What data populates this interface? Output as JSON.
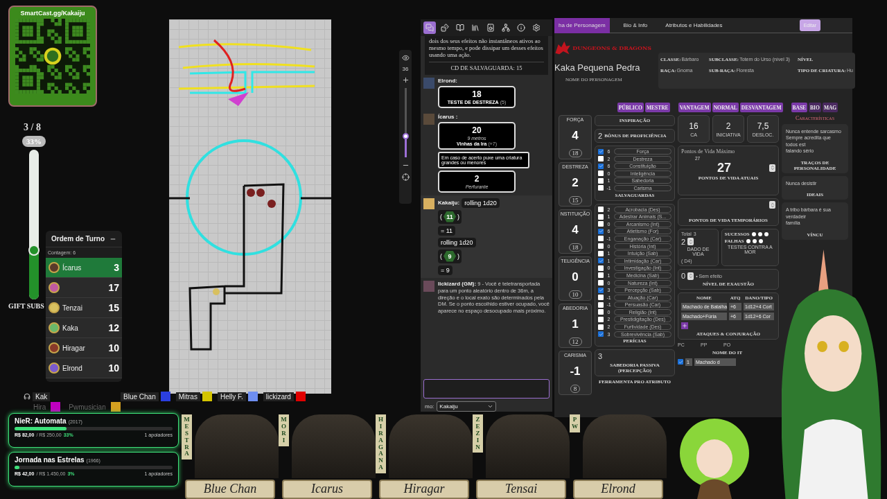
{
  "qr_widget": {
    "url": "SmartCast.gg/Kakaiju"
  },
  "sub_goal": {
    "count": "3 / 8",
    "percent": "33%",
    "level": 0.33,
    "label": "GIFT SUBS"
  },
  "turn_order": {
    "title": "Ordem de Turno",
    "count": "Contagem: 6",
    "entries": [
      {
        "name": "Ícarus",
        "initiative": "3",
        "selected": true
      },
      {
        "initiative": "17",
        "selected": false
      },
      {
        "name": "Tenzai",
        "initiative": "15",
        "selected": false
      },
      {
        "name": "Kaka",
        "initiative": "12",
        "selected": false
      },
      {
        "name": "Hiragar",
        "initiative": "10",
        "selected": false
      },
      {
        "name": "Elrond",
        "initiative": "10",
        "selected": false
      }
    ]
  },
  "map_toolbar": {
    "zoom": "36",
    "zoom_slider": {
      "level": 0.3
    }
  },
  "voice_members": [
    {
      "name": "Kak",
      "kind": "speaking"
    },
    {
      "name": "Blue Chan",
      "kind": "member",
      "color": "#2b3fe0"
    },
    {
      "name": "Mitras",
      "kind": "member",
      "color": "#d4c400"
    },
    {
      "name": "Helly F.",
      "kind": "member",
      "color": "#6e8ef0"
    },
    {
      "name": "lickizard",
      "kind": "member",
      "color": "#e00000"
    }
  ],
  "voice_members_faded": [
    {
      "name": "Hira",
      "color": "#c000c0"
    },
    {
      "name": "Pwmusician",
      "color": "#d4a020"
    }
  ],
  "funding_goals": [
    {
      "title": "NieR: Automata",
      "year": "(2017)",
      "raised": "R$ 82,00",
      "target": "/ R$ 250,00",
      "percent": "33%",
      "level": 0.33,
      "supporters": "1 apoiadores"
    },
    {
      "title": "Jornada nas Estrelas",
      "year": "(1966)",
      "raised": "R$ 42,00",
      "target": "/ R$ 1.450,00",
      "percent": "3%",
      "level": 0.03,
      "supporters": "1 apoiadores"
    }
  ],
  "chat": {
    "tabs": [
      {
        "kind": "chat",
        "selected": true
      },
      {
        "kind": "dice",
        "selected": false
      },
      {
        "kind": "journal",
        "selected": false
      },
      {
        "kind": "library",
        "selected": false
      },
      {
        "kind": "audio",
        "selected": false
      },
      {
        "kind": "nodes",
        "selected": false
      },
      {
        "kind": "info",
        "selected": false
      },
      {
        "kind": "settings",
        "selected": false
      }
    ],
    "spell_text": "dois dos seus efeitos não instantâneos ativos ao mesmo tempo, e pode dissipar um desses efeitos usando uma ação.",
    "spell_save": "CD DE SALVAGUARDA: 15",
    "messages": [
      {
        "kind": "roll_card",
        "author": "Elrond:",
        "total": "18",
        "label": "TESTE DE DESTREZA",
        "modifier": "(5)"
      },
      {
        "kind": "attack_card",
        "author": "Ícarus :",
        "total": "20",
        "range": "9 metros",
        "label": "Vinhas da Ira",
        "modifier": "(+7)",
        "description": "Em caso de acerto puxe uma criatura grandes ou menores",
        "damage": "2",
        "damage_type": "Perfurante"
      },
      {
        "kind": "dice",
        "author": "Kakaiju:",
        "rolls": [
          {
            "command": "rolling 1d20",
            "open": "(",
            "value": "11",
            "close": ")",
            "result": "= 11"
          },
          {
            "command": "rolling 1d20",
            "open": "(",
            "value": "9",
            "close": ")",
            "result": "= 9"
          }
        ]
      },
      {
        "kind": "text",
        "author": "lickizard (GM):",
        "text": "9 - Você é teletransportada para um ponto aleatório dentro de 36m, a direção e o local exato são determinados pela DM. Se o ponto escolhido estiver ocupado, você aparece no espaço desocupado mais próximo."
      }
    ],
    "as_label": "mo:",
    "as_value": "Kakaiju"
  },
  "sheet": {
    "tabs": [
      {
        "label": "ha de Personagem",
        "selected": true
      },
      {
        "label": "Bio & Info",
        "selected": false
      },
      {
        "label": "Atributos e Habilidades",
        "selected": false
      }
    ],
    "edit_button": "Editar",
    "logo": "DUNGEONS & DRAGONS",
    "character_name": "Kaka Pequena Pedra",
    "name_label": "NOME DO PERSONAGEM",
    "info": [
      {
        "label": "CLASSE:",
        "value": "Bárbaro"
      },
      {
        "label": "SUBCLASSE:",
        "value": "Totem do Urso (nível 3)"
      },
      {
        "label": "NÍVEL"
      },
      {
        "label": "RAÇA:",
        "value": "Gnoma"
      },
      {
        "label": "SUB-RAÇA:",
        "value": "Floresta"
      },
      {
        "label": "TIPO DE CRIATURA:",
        "value": "Hu"
      }
    ],
    "toggle_groups": [
      [
        {
          "label": "PÚBLICO",
          "selected": true
        },
        {
          "label": "MESTRE",
          "selected": true
        }
      ],
      [
        {
          "label": "VANTAGEM",
          "selected": true
        },
        {
          "label": "NORMAL",
          "selected": true
        },
        {
          "label": "DESVANTAGEM",
          "selected": true
        }
      ],
      [
        {
          "label": "BASE",
          "selected": true
        },
        {
          "label": "BIO",
          "selected": false
        },
        {
          "label": "MAG",
          "selected": false
        }
      ]
    ],
    "abilities": [
      {
        "label": "FORÇA",
        "modifier": "4",
        "score": "18"
      },
      {
        "label": "DESTREZA",
        "modifier": "2",
        "score": "15"
      },
      {
        "label": "NSTITUIÇÃO",
        "modifier": "4",
        "score": "18"
      },
      {
        "label": "TELIGÊNCIA",
        "modifier": "0",
        "score": "10"
      },
      {
        "label": "ABEDORIA",
        "modifier": "1",
        "score": "12"
      },
      {
        "label": "CARISMA",
        "modifier": "-1",
        "score": "8"
      }
    ],
    "inspiration": "INSPIRAÇÃO",
    "proficiency": {
      "value": "2",
      "label": "BÔNUS DE PROFICIÊNCIA"
    },
    "saves_title": "SALVAGUARDAS",
    "saves": [
      {
        "value": "6",
        "name": "Força",
        "checked": true
      },
      {
        "value": "2",
        "name": "Destreza",
        "checked": false
      },
      {
        "value": "6",
        "name": "Constituição",
        "checked": true
      },
      {
        "value": "0",
        "name": "Inteligência",
        "checked": false
      },
      {
        "value": "1",
        "name": "Sabedoria",
        "checked": false
      },
      {
        "value": "-1",
        "name": "Carisma",
        "checked": false
      }
    ],
    "skills_title": "PERÍCIAS",
    "skills": [
      {
        "value": "2",
        "name": "Acrobacia (Des)",
        "checked": false
      },
      {
        "value": "1",
        "name": "Adestrar Animais (S...",
        "checked": false
      },
      {
        "value": "0",
        "name": "Arcanismo (Int)",
        "checked": false
      },
      {
        "value": "6",
        "name": "Atletismo (For)",
        "checked": true
      },
      {
        "value": "-1",
        "name": "Enganação (Car)",
        "checked": false
      },
      {
        "value": "0",
        "name": "História (Int)",
        "checked": false
      },
      {
        "value": "1",
        "name": "Intuição (Sab)",
        "checked": false
      },
      {
        "value": "1",
        "name": "Intimidação (Car)",
        "checked": true
      },
      {
        "value": "0",
        "name": "Investigação (Int)",
        "checked": false
      },
      {
        "value": "1",
        "name": "Medicina (Sab)",
        "checked": false
      },
      {
        "value": "0",
        "name": "Natureza (Int)",
        "checked": false
      },
      {
        "value": "3",
        "name": "Percepção (Sab)",
        "checked": true
      },
      {
        "value": "-1",
        "name": "Atuação (Car)",
        "checked": false
      },
      {
        "value": "-1",
        "name": "Persuasão (Car)",
        "checked": false
      },
      {
        "value": "0",
        "name": "Religião (Int)",
        "checked": false
      },
      {
        "value": "2",
        "name": "Prestidigitação (Des)",
        "checked": false
      },
      {
        "value": "2",
        "name": "Furtividade (Des)",
        "checked": false
      },
      {
        "value": "3",
        "name": "Sobrevivência (Sab)",
        "checked": true
      }
    ],
    "passive": {
      "value": "3",
      "label": "SABEDORIA PASSIVA (PERCEPÇÃO)"
    },
    "tools_header": [
      "FERRAMENTA",
      "PRO",
      "ATRIBUTO"
    ],
    "armor": {
      "value": "16",
      "label": "CA"
    },
    "initiative": {
      "value": "2",
      "label": "INICIATIVA"
    },
    "speed": {
      "value": "7,5",
      "label": "DESLOC."
    },
    "hp": {
      "max_label": "Pontos de Vida Máximo",
      "max": "27",
      "current": "27",
      "current_label": "PONTOS DE VIDA ATUAIS",
      "temp_label": "PONTOS DE VIDA TEMPORÁRIOS"
    },
    "hit_dice": {
      "total_label": "Total",
      "total": "3",
      "value": "2",
      "label": "DADO DE VIDA",
      "die": "( D4)"
    },
    "death_saves": {
      "successes_label": "SUCESSOS",
      "failures_label": "FALHAS",
      "label": "TESTES CONTRA A MOR"
    },
    "exhaustion": {
      "value": "0",
      "note": "• Sem efeito",
      "label": "NÍVEL DE EXAUSTÃO"
    },
    "attacks": {
      "header": [
        "NOME",
        "ATQ",
        "DANO/TIPO"
      ],
      "rows": [
        [
          "Machado de Batalha",
          "+6",
          "1d12+4 Cort"
        ],
        [
          "Machado+Fúria",
          "+6",
          "1d12+6 Cor"
        ]
      ],
      "title": "ATAQUES & CONJURAÇÃO"
    },
    "coins": [
      "PC",
      "PP",
      "PO"
    ],
    "items": {
      "header": "NOME DO IT",
      "rows": [
        {
          "qty": "1",
          "name": "Machado d",
          "checked": true
        }
      ]
    },
    "characteristics": {
      "title": "Características",
      "blocks": [
        {
          "text": "Nunca entende sarcasmo\nSempre acredita que todos est\nfalando sério",
          "label": "TRAÇOS DE PERSONALIDADE"
        },
        {
          "text": "Nunca desistir",
          "label": "IDEAIS"
        },
        {
          "text": "A tribo bárbara é sua verdadeir\nfamília",
          "label": "VÍNCU"
        }
      ]
    }
  },
  "party_banners": [
    {
      "tag": "MESTRA",
      "name": "Blue Chan"
    },
    {
      "tag": "MORI",
      "name": "Icarus"
    },
    {
      "tag": "HIRAGANA",
      "name": "Hiragar"
    },
    {
      "tag": "ZEZIN",
      "name": "Tensai"
    },
    {
      "tag": "PW",
      "name": "Elrond"
    }
  ]
}
